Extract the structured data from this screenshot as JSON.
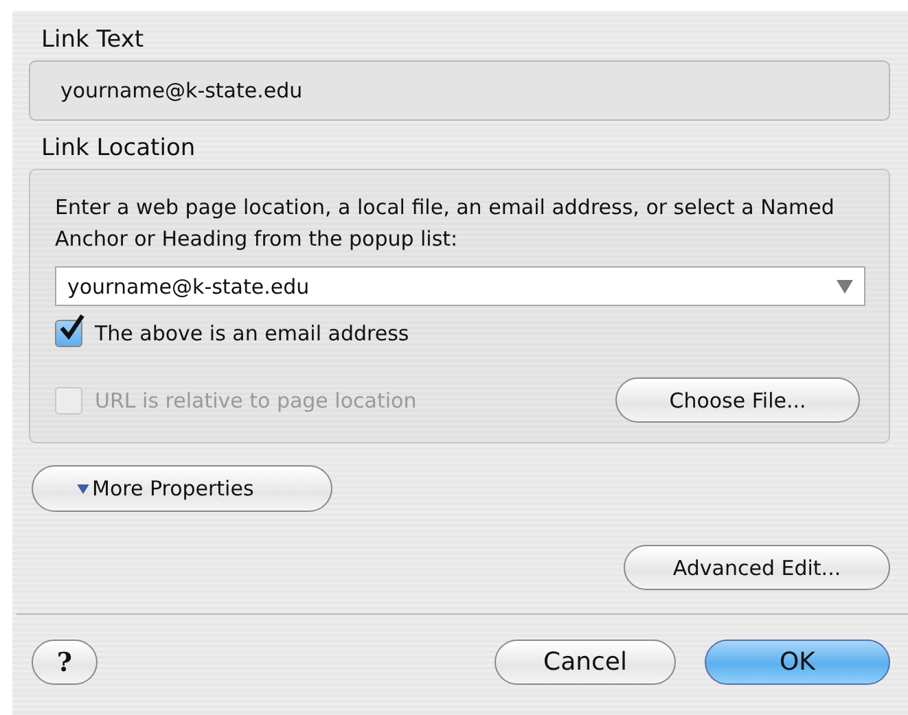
{
  "link_text": {
    "label": "Link Text",
    "value": "yourname@k-state.edu"
  },
  "link_location": {
    "label": "Link Location",
    "description": "Enter a web page location, a local file, an email address, or select a Named Anchor or Heading from the popup list:",
    "value": "yourname@k-state.edu",
    "checkboxes": [
      {
        "label": "The above is an email address",
        "checked": true,
        "disabled": false
      },
      {
        "label": "URL is relative to page location",
        "checked": false,
        "disabled": true
      }
    ],
    "choose_button": "Choose File..."
  },
  "more_properties": {
    "label": "More Properties",
    "expanded": false
  },
  "advanced_button": "Advanced Edit...",
  "footer_buttons": [
    {
      "label": "?",
      "kind": "help"
    },
    {
      "label": "Cancel",
      "kind": "normal"
    },
    {
      "label": "OK",
      "kind": "default"
    }
  ]
}
